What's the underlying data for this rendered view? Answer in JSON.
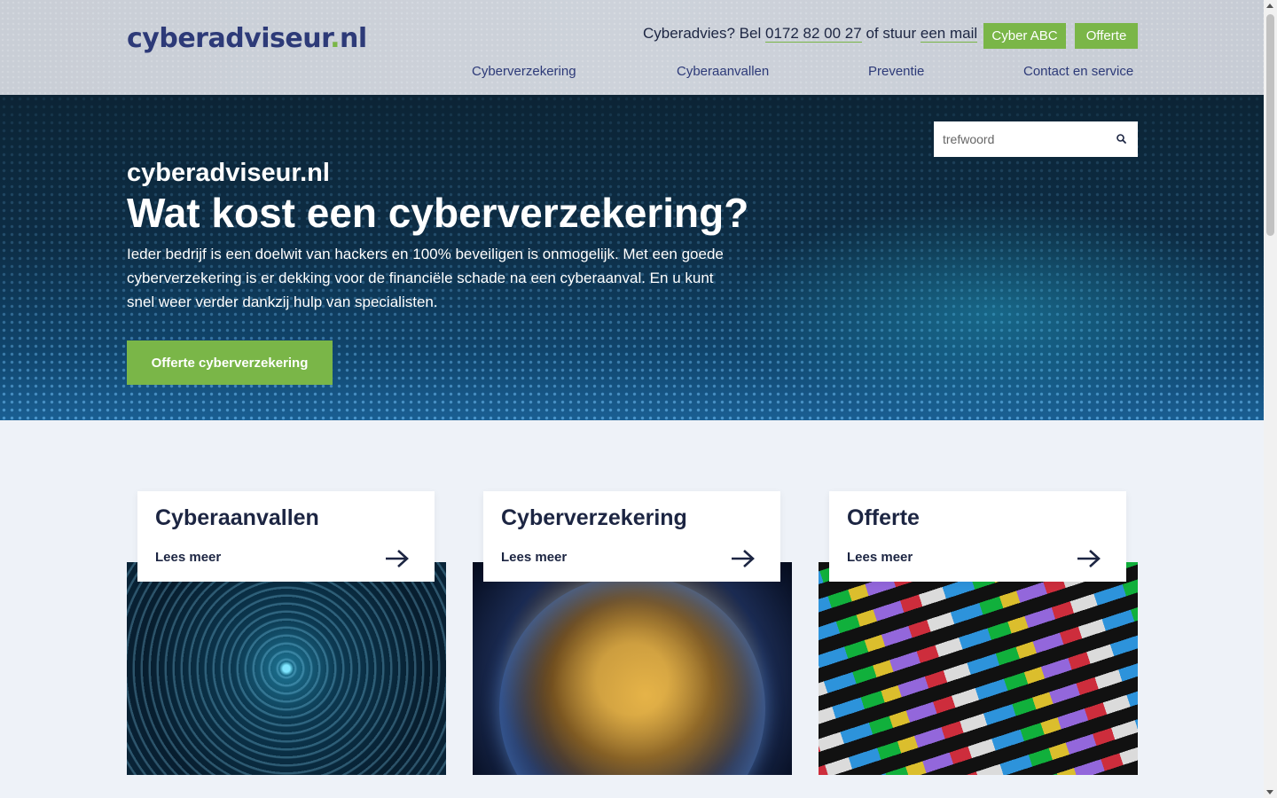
{
  "header": {
    "logo_main": "cyberadviseur",
    "logo_dot": ".",
    "logo_tld": "nl",
    "contact_prefix": "Cyberadvies? Bel",
    "phone": "0172 82 00 27",
    "contact_mid": "of stuur",
    "mail_label": "een mail",
    "btn_abc": "Cyber ABC",
    "btn_offerte": "Offerte",
    "nav": [
      "Cyberverzekering",
      "Cyberaanvallen",
      "Preventie",
      "Contact en service"
    ]
  },
  "search": {
    "placeholder": "trefwoord",
    "icon": "search-icon"
  },
  "hero": {
    "subtitle": "cyberadviseur.nl",
    "title": "Wat kost een cyberverzekering?",
    "text": "Ieder bedrijf is een doelwit van hackers en 100% beveiligen is onmogelijk. Met een goede cyberverzekering is er dekking voor de financiële schade na een cyberaanval. En u kunt snel weer verder dankzij hulp van specialisten.",
    "cta": "Offerte cyberverzekering"
  },
  "cards": [
    {
      "title": "Cyberaanvallen",
      "more": "Lees meer",
      "icon": "arrow-right-icon"
    },
    {
      "title": "Cyberverzekering",
      "more": "Lees meer",
      "icon": "arrow-right-icon"
    },
    {
      "title": "Offerte",
      "more": "Lees meer",
      "icon": "arrow-right-icon"
    }
  ],
  "colors": {
    "brand": "#2d3a78",
    "accent": "#7ab648",
    "text": "#1c2542"
  }
}
